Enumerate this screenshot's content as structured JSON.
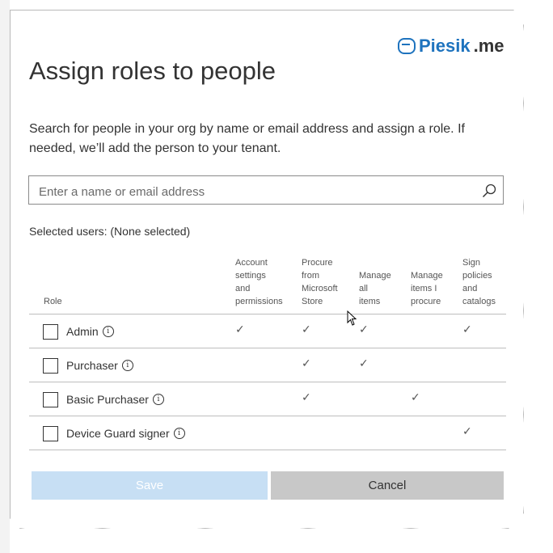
{
  "brand": {
    "text_main": "Piesik",
    "text_suffix": ".me"
  },
  "dialog": {
    "title": "Assign roles to people",
    "description": "Search for people in your org by name or email address and assign a role. If needed, we’ll add the person to your tenant."
  },
  "search": {
    "placeholder": "Enter a name or email address",
    "value": ""
  },
  "selected_users": "Selected users: (None selected)",
  "table": {
    "columns": [
      "Role",
      "Account\nsettings\nand\npermissions",
      "Procure\nfrom\nMicrosoft\nStore",
      "Manage\nall\nitems",
      "Manage\nitems I\nprocure",
      "Sign\npolicies\nand\ncatalogs"
    ],
    "rows": [
      {
        "role": "Admin",
        "ticks": [
          "✓",
          "✓",
          "✓",
          "",
          "✓"
        ]
      },
      {
        "role": "Purchaser",
        "ticks": [
          "",
          "✓",
          "✓",
          "",
          ""
        ]
      },
      {
        "role": "Basic Purchaser",
        "ticks": [
          "",
          "✓",
          "",
          "✓",
          ""
        ]
      },
      {
        "role": "Device Guard signer",
        "ticks": [
          "",
          "",
          "",
          "",
          "✓"
        ]
      }
    ]
  },
  "buttons": {
    "save": "Save",
    "cancel": "Cancel"
  },
  "colors": {
    "accent": "#1e73be",
    "save_disabled": "#c7dff4",
    "cancel_bg": "#c8c8c8"
  },
  "icons": {
    "search": "search-icon",
    "info": "info-icon",
    "brand": "chat-bubble-icon"
  }
}
